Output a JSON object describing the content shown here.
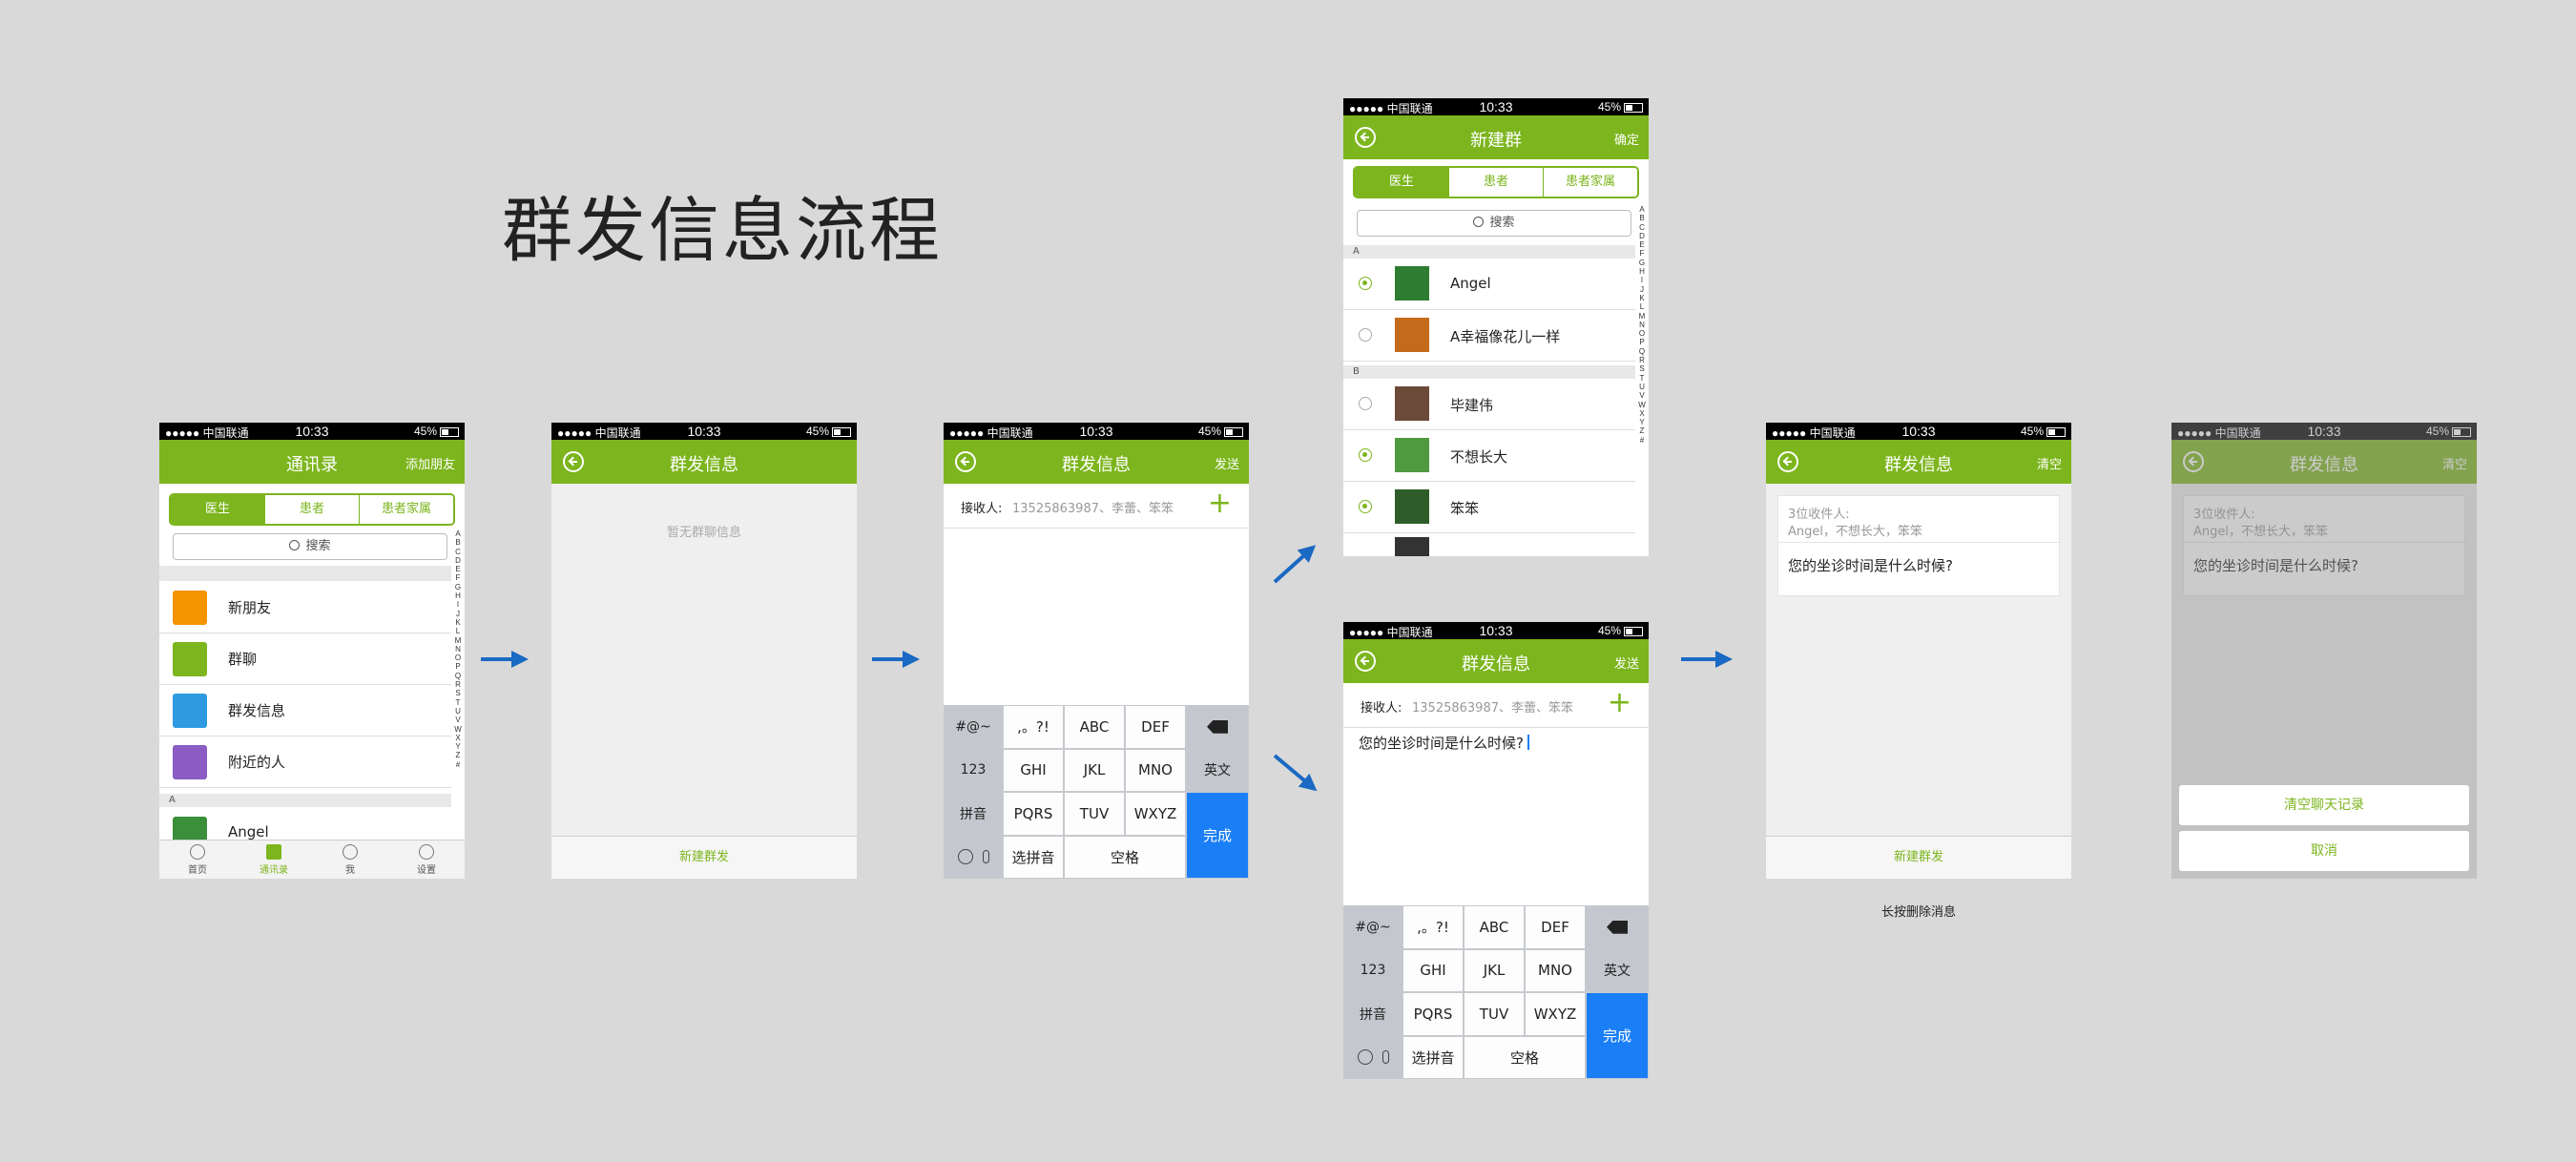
{
  "page_title": "群发信息流程",
  "status": {
    "carrier": "●●●●● 中国联通 ",
    "time": "10:33",
    "battery": "45%"
  },
  "colors": {
    "accent": "#7cb51d",
    "keyboard_done": "#1a7ef6",
    "arrow": "#1a69c2"
  },
  "contacts_screen": {
    "title": "通讯录",
    "add_friend": "添加朋友",
    "segments": [
      "医生",
      "患者",
      "患者家属"
    ],
    "search_placeholder": "搜索",
    "items": [
      {
        "label": "新朋友",
        "icon": "new-friend-icon",
        "color": "#f39400"
      },
      {
        "label": "群聊",
        "icon": "group-chat-icon",
        "color": "#7cb51d"
      },
      {
        "label": "群发信息",
        "icon": "broadcast-icon",
        "color": "#2e9be0"
      },
      {
        "label": "附近的人",
        "icon": "nearby-icon",
        "color": "#8a5cc4"
      }
    ],
    "section_a": "A",
    "partial_contact": "Angel",
    "tabs": [
      "首页",
      "通讯录",
      "我",
      "设置"
    ]
  },
  "index_letters": [
    "A",
    "B",
    "C",
    "D",
    "E",
    "F",
    "G",
    "H",
    "I",
    "J",
    "K",
    "L",
    "M",
    "N",
    "O",
    "P",
    "Q",
    "R",
    "S",
    "T",
    "U",
    "V",
    "W",
    "X",
    "Y",
    "Z",
    "#"
  ],
  "empty_screen": {
    "title": "群发信息",
    "empty_text": "暂无群聊信息",
    "bottom": "新建群发"
  },
  "compose_screen": {
    "title": "群发信息",
    "send": "发送",
    "recipient_key": "接收人:",
    "recipient_value": "13525863987、李蕾、笨笨",
    "plus": "+"
  },
  "keyboard": {
    "r1": [
      "#@~",
      ",。?!",
      "ABC",
      "DEF"
    ],
    "r2": [
      "123",
      "GHI",
      "JKL",
      "MNO",
      "英文"
    ],
    "r3": [
      "拼音",
      "PQRS",
      "TUV",
      "WXYZ"
    ],
    "r4": [
      "选拼音",
      "空格"
    ],
    "done": "完成"
  },
  "new_group_screen": {
    "title": "新建群",
    "confirm": "确定",
    "segments": [
      "医生",
      "患者",
      "患者家属"
    ],
    "search_placeholder": "搜索",
    "section_a": "A",
    "section_b": "B",
    "contacts": [
      {
        "name": "Angel",
        "selected": true
      },
      {
        "name": "A幸福像花儿一样",
        "selected": false
      },
      {
        "name": "毕建伟",
        "selected": false
      },
      {
        "name": "不想长大",
        "selected": true
      },
      {
        "name": "笨笨",
        "selected": true
      }
    ]
  },
  "compose_filled_screen": {
    "title": "群发信息",
    "send": "发送",
    "recipient_key": "接收人:",
    "recipient_value": "13525863987、李蕾、笨笨",
    "message": "您的坐诊时间是什么时候?"
  },
  "sent_screen": {
    "title": "群发信息",
    "clear": "清空",
    "count_line": "3位收件人:",
    "names_line": "Angel，不想长大，笨笨",
    "message": "您的坐诊时间是什么时候?",
    "bottom": "新建群发",
    "caption": "长按删除消息"
  },
  "clear_sheet": {
    "clear_history": "清空聊天记录",
    "cancel": "取消"
  }
}
